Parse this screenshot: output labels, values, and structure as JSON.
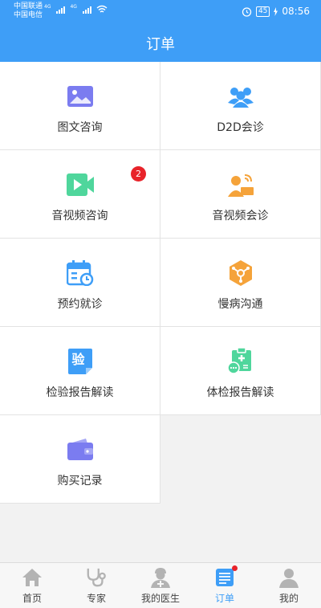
{
  "status_bar": {
    "carrier_1": "中国联通",
    "carrier_2": "中国电信",
    "network_1": "4G",
    "network_2": "4G",
    "battery": "45",
    "time": "08:56",
    "icons": [
      "signal-icon",
      "wifi-icon",
      "alarm-icon",
      "battery-icon",
      "charging-icon"
    ]
  },
  "header": {
    "title": "订单"
  },
  "menu": {
    "items": [
      {
        "label": "图文咨询",
        "icon": "image-icon"
      },
      {
        "label": "D2D会诊",
        "icon": "group-icon"
      },
      {
        "label": "音视频咨询",
        "icon": "video-icon",
        "badge": "2"
      },
      {
        "label": "音视频会诊",
        "icon": "doctor-broadcast-icon"
      },
      {
        "label": "预约就诊",
        "icon": "calendar-icon"
      },
      {
        "label": "慢病沟通",
        "icon": "chronic-disease-icon"
      },
      {
        "label": "检验报告解读",
        "icon": "lab-report-icon",
        "icon_text": "验"
      },
      {
        "label": "体检报告解读",
        "icon": "medical-checkup-icon"
      },
      {
        "label": "购买记录",
        "icon": "wallet-icon"
      }
    ]
  },
  "tabbar": {
    "tabs": [
      {
        "label": "首页",
        "icon": "home-icon"
      },
      {
        "label": "专家",
        "icon": "stethoscope-icon"
      },
      {
        "label": "我的医生",
        "icon": "doctor-icon"
      },
      {
        "label": "订单",
        "icon": "order-icon",
        "active": true
      },
      {
        "label": "我的",
        "icon": "user-icon"
      }
    ]
  },
  "colors": {
    "primary": "#3e9ef7",
    "badge": "#e8232a",
    "purple": "#7b7cf0",
    "green": "#4fd69c",
    "orange": "#f5a33a"
  }
}
